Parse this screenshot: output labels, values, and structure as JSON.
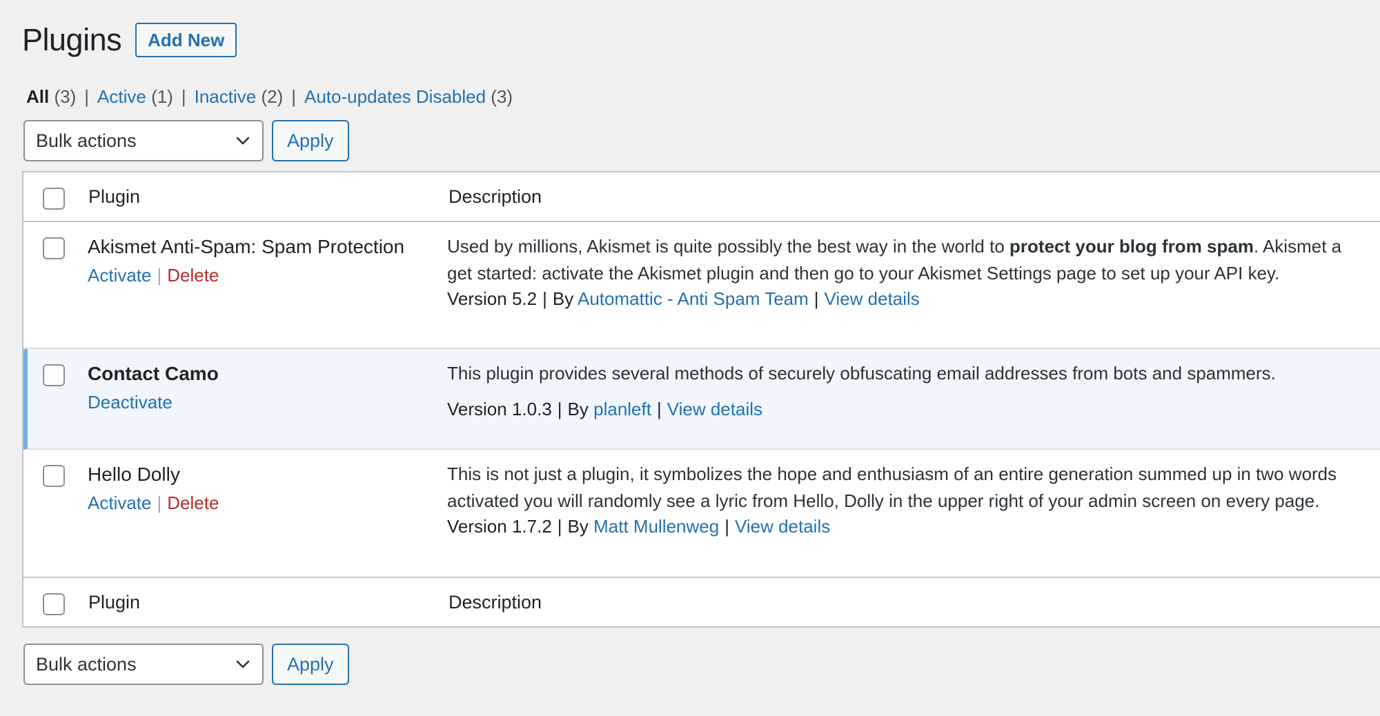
{
  "header": {
    "title": "Plugins",
    "add_new": "Add New"
  },
  "filters": {
    "all_label": "All",
    "all_count": "(3)",
    "active_label": "Active",
    "active_count": "(1)",
    "inactive_label": "Inactive",
    "inactive_count": "(2)",
    "autoupdates_label": "Auto-updates Disabled",
    "autoupdates_count": "(3)"
  },
  "bulk": {
    "selected": "Bulk actions",
    "apply": "Apply"
  },
  "columns": {
    "plugin": "Plugin",
    "description": "Description"
  },
  "plugins": [
    {
      "name": "Akismet Anti-Spam: Spam Protection",
      "action1": "Activate",
      "action2": "Delete",
      "desc_line1_pre": "Used by millions, Akismet is quite possibly the best way in the world to ",
      "desc_line1_bold": "protect your blog from spam",
      "desc_line1_post": ". Akismet a",
      "desc_line2": "get started: activate the Akismet plugin and then go to your Akismet Settings page to set up your API key.",
      "version": "Version 5.2",
      "by": "By",
      "author": "Automattic - Anti Spam Team",
      "view_details": "View details"
    },
    {
      "name": "Contact Camo",
      "action1": "Deactivate",
      "desc_line1": "This plugin provides several methods of securely obfuscating email addresses from bots and spammers.",
      "version": "Version 1.0.3",
      "by": "By",
      "author": "planleft",
      "view_details": "View details"
    },
    {
      "name": "Hello Dolly",
      "action1": "Activate",
      "action2": "Delete",
      "desc_line1": "This is not just a plugin, it symbolizes the hope and enthusiasm of an entire generation summed up in two words",
      "desc_line2": "activated you will randomly see a lyric from Hello, Dolly in the upper right of your admin screen on every page.",
      "version": "Version 1.7.2",
      "by": "By",
      "author": "Matt Mullenweg",
      "view_details": "View details"
    }
  ]
}
